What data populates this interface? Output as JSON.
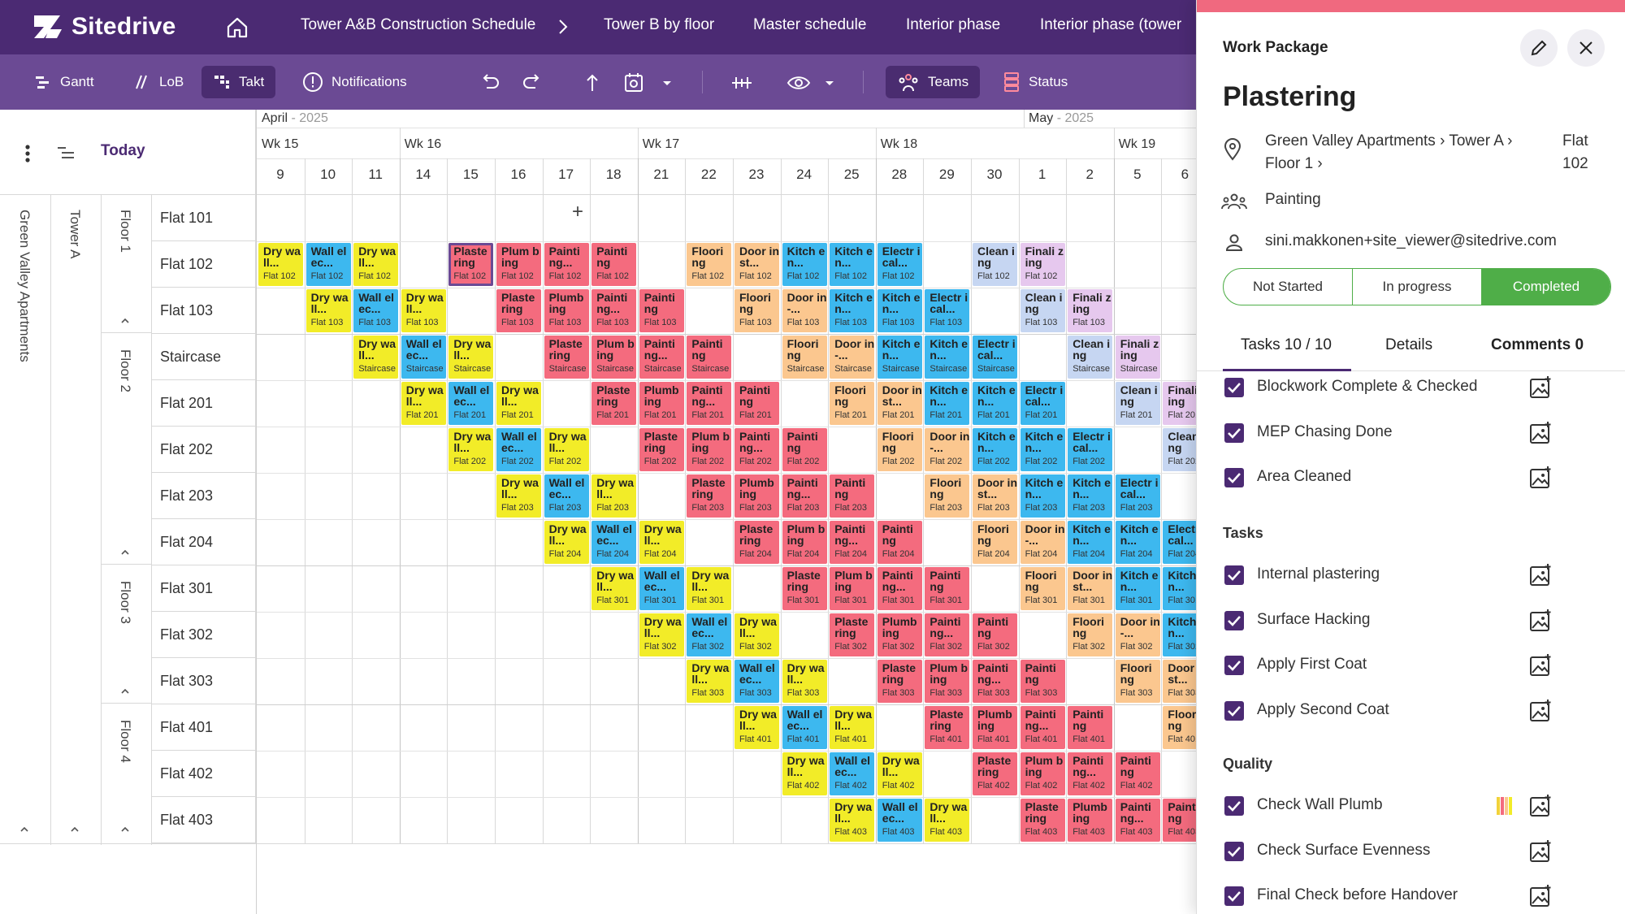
{
  "nav": {
    "logo": "Sitedrive",
    "breadcrumbs": [
      "Tower A&B Construction Schedule",
      "Tower B by floor",
      "Master schedule",
      "Interior phase",
      "Interior phase (tower"
    ]
  },
  "toolbar": {
    "gantt": "Gantt",
    "lob": "LoB",
    "takt": "Takt",
    "notifications": "Notifications",
    "teams": "Teams",
    "status": "Status"
  },
  "sidebar": {
    "today": "Today",
    "project": "Green Valley Apartments",
    "tower": "Tower A",
    "floors": [
      "Floor 1",
      "Floor 2",
      "Floor 3",
      "Floor 4"
    ],
    "rows": [
      "Flat 101",
      "Flat 102",
      "Flat 103",
      "Staircase",
      "Flat 201",
      "Flat 202",
      "Flat 203",
      "Flat 204",
      "Flat 301",
      "Flat 302",
      "Flat 303",
      "Flat 401",
      "Flat 402",
      "Flat 403"
    ]
  },
  "timeline": {
    "months": [
      {
        "name": "April",
        "year": "- 2025"
      },
      {
        "name": "May",
        "year": "- 2025"
      }
    ],
    "weeks": [
      "Wk 15",
      "Wk 16",
      "Wk 17",
      "Wk 18",
      "Wk 19"
    ],
    "days": [
      "9",
      "10",
      "11",
      "14",
      "15",
      "16",
      "17",
      "18",
      "21",
      "22",
      "23",
      "24",
      "25",
      "28",
      "29",
      "30",
      "1",
      "2",
      "5",
      "6"
    ],
    "add_symbol": "+"
  },
  "tasks": {
    "dry": {
      "label": "Dry wall...",
      "color": "#f2ec28"
    },
    "elec": {
      "label": "Wall elec...",
      "color": "#3db8ef"
    },
    "plast": {
      "label": "Plaste ring",
      "color": "#f46b7e"
    },
    "plumb": {
      "label": "Plum bing",
      "color": "#f46b7e"
    },
    "plumb2": {
      "label": "Plumb ing",
      "color": "#f46b7e"
    },
    "paint": {
      "label": "Painti ng",
      "color": "#f46b7e"
    },
    "paint2": {
      "label": "Painti ng...",
      "color": "#f46b7e"
    },
    "floor": {
      "label": "Floori ng",
      "color": "#fbc78f"
    },
    "door": {
      "label": "Door inst...",
      "color": "#fbc78f"
    },
    "door2": {
      "label": "Door in-...",
      "color": "#fbc78f"
    },
    "kitch": {
      "label": "Kitch en...",
      "color": "#3db8ef"
    },
    "electr": {
      "label": "Electr ical...",
      "color": "#3db8ef"
    },
    "clean": {
      "label": "Clean ing",
      "color": "#c6d6f2"
    },
    "final": {
      "label": "Finali zing",
      "color": "#e6c8ee"
    }
  },
  "schedule": [
    {
      "row": 1,
      "flat": "Flat 102",
      "cells": [
        [
          0,
          "dry"
        ],
        [
          1,
          "elec"
        ],
        [
          2,
          "dry"
        ],
        [
          4,
          "plast"
        ],
        [
          5,
          "plumb"
        ],
        [
          6,
          "paint2"
        ],
        [
          7,
          "paint"
        ],
        [
          9,
          "floor"
        ],
        [
          10,
          "door"
        ],
        [
          11,
          "kitch"
        ],
        [
          12,
          "kitch"
        ],
        [
          13,
          "electr"
        ],
        [
          15,
          "clean"
        ],
        [
          16,
          "final"
        ]
      ]
    },
    {
      "row": 2,
      "flat": "Flat 103",
      "cells": [
        [
          1,
          "dry"
        ],
        [
          2,
          "elec"
        ],
        [
          3,
          "dry"
        ],
        [
          5,
          "plast"
        ],
        [
          6,
          "plumb2"
        ],
        [
          7,
          "paint2"
        ],
        [
          8,
          "paint"
        ],
        [
          10,
          "floor"
        ],
        [
          11,
          "door2"
        ],
        [
          12,
          "kitch"
        ],
        [
          13,
          "kitch"
        ],
        [
          14,
          "electr"
        ],
        [
          16,
          "clean"
        ],
        [
          17,
          "final"
        ]
      ]
    },
    {
      "row": 3,
      "flat": "Staircase",
      "cells": [
        [
          2,
          "dry"
        ],
        [
          3,
          "elec"
        ],
        [
          4,
          "dry"
        ],
        [
          6,
          "plast"
        ],
        [
          7,
          "plumb"
        ],
        [
          8,
          "paint2"
        ],
        [
          9,
          "paint"
        ],
        [
          11,
          "floor"
        ],
        [
          12,
          "door2"
        ],
        [
          13,
          "kitch"
        ],
        [
          14,
          "kitch"
        ],
        [
          15,
          "electr"
        ],
        [
          17,
          "clean"
        ],
        [
          18,
          "final"
        ]
      ]
    },
    {
      "row": 4,
      "flat": "Flat 201",
      "cells": [
        [
          3,
          "dry"
        ],
        [
          4,
          "elec"
        ],
        [
          5,
          "dry"
        ],
        [
          7,
          "plast"
        ],
        [
          8,
          "plumb2"
        ],
        [
          9,
          "paint2"
        ],
        [
          10,
          "paint"
        ],
        [
          12,
          "floor"
        ],
        [
          13,
          "door"
        ],
        [
          14,
          "kitch"
        ],
        [
          15,
          "kitch"
        ],
        [
          16,
          "electr"
        ],
        [
          18,
          "clean"
        ],
        [
          19,
          "final"
        ]
      ]
    },
    {
      "row": 5,
      "flat": "Flat 202",
      "cells": [
        [
          4,
          "dry"
        ],
        [
          5,
          "elec"
        ],
        [
          6,
          "dry"
        ],
        [
          8,
          "plast"
        ],
        [
          9,
          "plumb"
        ],
        [
          10,
          "paint2"
        ],
        [
          11,
          "paint"
        ],
        [
          13,
          "floor"
        ],
        [
          14,
          "door2"
        ],
        [
          15,
          "kitch"
        ],
        [
          16,
          "kitch"
        ],
        [
          17,
          "electr"
        ],
        [
          19,
          "clean"
        ]
      ]
    },
    {
      "row": 6,
      "flat": "Flat 203",
      "cells": [
        [
          5,
          "dry"
        ],
        [
          6,
          "elec"
        ],
        [
          7,
          "dry"
        ],
        [
          9,
          "plast"
        ],
        [
          10,
          "plumb2"
        ],
        [
          11,
          "paint2"
        ],
        [
          12,
          "paint"
        ],
        [
          14,
          "floor"
        ],
        [
          15,
          "door"
        ],
        [
          16,
          "kitch"
        ],
        [
          17,
          "kitch"
        ],
        [
          18,
          "electr"
        ]
      ]
    },
    {
      "row": 7,
      "flat": "Flat 204",
      "cells": [
        [
          6,
          "dry"
        ],
        [
          7,
          "elec"
        ],
        [
          8,
          "dry"
        ],
        [
          10,
          "plast"
        ],
        [
          11,
          "plumb"
        ],
        [
          12,
          "paint2"
        ],
        [
          13,
          "paint"
        ],
        [
          15,
          "floor"
        ],
        [
          16,
          "door2"
        ],
        [
          17,
          "kitch"
        ],
        [
          18,
          "kitch"
        ],
        [
          19,
          "electr"
        ]
      ]
    },
    {
      "row": 8,
      "flat": "Flat 301",
      "cells": [
        [
          7,
          "dry"
        ],
        [
          8,
          "elec"
        ],
        [
          9,
          "dry"
        ],
        [
          11,
          "plast"
        ],
        [
          12,
          "plumb"
        ],
        [
          13,
          "paint2"
        ],
        [
          14,
          "paint"
        ],
        [
          16,
          "floor"
        ],
        [
          17,
          "door"
        ],
        [
          18,
          "kitch"
        ],
        [
          19,
          "kitch"
        ]
      ]
    },
    {
      "row": 9,
      "flat": "Flat 302",
      "cells": [
        [
          8,
          "dry"
        ],
        [
          9,
          "elec"
        ],
        [
          10,
          "dry"
        ],
        [
          12,
          "plast"
        ],
        [
          13,
          "plumb2"
        ],
        [
          14,
          "paint2"
        ],
        [
          15,
          "paint"
        ],
        [
          17,
          "floor"
        ],
        [
          18,
          "door2"
        ],
        [
          19,
          "kitch"
        ]
      ]
    },
    {
      "row": 10,
      "flat": "Flat 303",
      "cells": [
        [
          9,
          "dry"
        ],
        [
          10,
          "elec"
        ],
        [
          11,
          "dry"
        ],
        [
          13,
          "plast"
        ],
        [
          14,
          "plumb"
        ],
        [
          15,
          "paint2"
        ],
        [
          16,
          "paint"
        ],
        [
          18,
          "floor"
        ],
        [
          19,
          "door"
        ]
      ]
    },
    {
      "row": 11,
      "flat": "Flat 401",
      "cells": [
        [
          10,
          "dry"
        ],
        [
          11,
          "elec"
        ],
        [
          12,
          "dry"
        ],
        [
          14,
          "plast"
        ],
        [
          15,
          "plumb2"
        ],
        [
          16,
          "paint2"
        ],
        [
          17,
          "paint"
        ],
        [
          19,
          "floor"
        ]
      ]
    },
    {
      "row": 12,
      "flat": "Flat 402",
      "cells": [
        [
          11,
          "dry"
        ],
        [
          12,
          "elec"
        ],
        [
          13,
          "dry"
        ],
        [
          15,
          "plast"
        ],
        [
          16,
          "plumb"
        ],
        [
          17,
          "paint2"
        ],
        [
          18,
          "paint"
        ]
      ]
    },
    {
      "row": 13,
      "flat": "Flat 403",
      "cells": [
        [
          12,
          "dry"
        ],
        [
          13,
          "elec"
        ],
        [
          14,
          "dry"
        ],
        [
          16,
          "plast"
        ],
        [
          17,
          "plumb2"
        ],
        [
          18,
          "paint2"
        ],
        [
          19,
          "paint"
        ]
      ]
    }
  ],
  "panel": {
    "header": "Work Package",
    "title": "Plastering",
    "location": "Green Valley Apartments › Tower A › Floor 1 ›",
    "location_flat": "Flat 102",
    "team": "Painting",
    "user": "sini.makkonen+site_viewer@sitedrive.com",
    "status": [
      "Not Started",
      "In progress",
      "Completed"
    ],
    "tabs": [
      "Tasks 10 / 10",
      "Details",
      "Comments 0"
    ],
    "prereq": [
      "Blockwork Complete & Checked",
      "MEP Chasing Done",
      "Area Cleaned"
    ],
    "tasks_heading": "Tasks",
    "tasks": [
      "Internal plastering",
      "Surface Hacking",
      "Apply First Coat",
      "Apply Second Coat"
    ],
    "quality_heading": "Quality",
    "quality": [
      "Check Wall Plumb",
      "Check Surface Evenness",
      "Final Check before Handover"
    ],
    "colors": {
      "brand": "#4b2a73",
      "completed": "#4fae48",
      "accent": "#f0697f"
    }
  }
}
